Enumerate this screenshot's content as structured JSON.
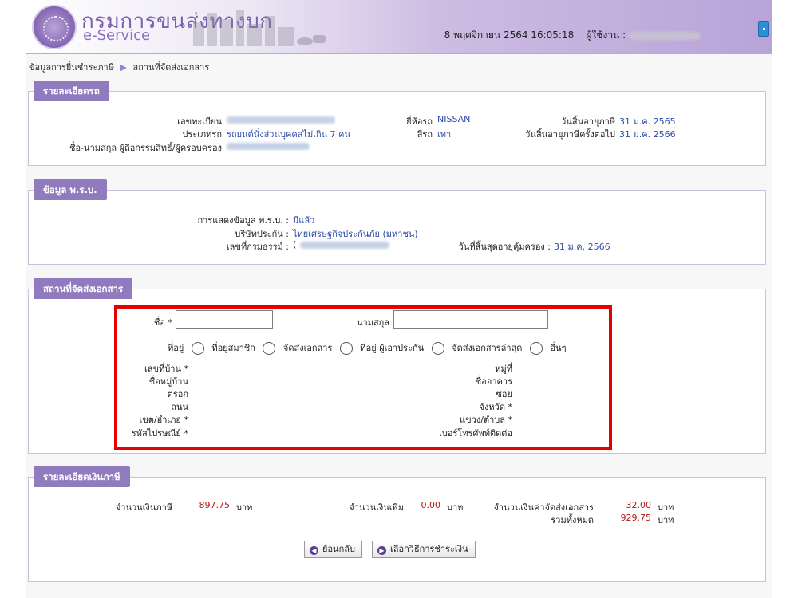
{
  "header": {
    "dept_name": "กรมการขนส่งทางบก",
    "eservice": "e-Service",
    "datetime": "8 พฤศจิกายน 2564 16:05:18",
    "user_label": "ผู้ใช้งาน :"
  },
  "breadcrumb": {
    "item1": "ข้อมูลการยื่นชำระภาษี",
    "item2": "สถานที่จัดส่งเอกสาร"
  },
  "vehicle": {
    "legend": "รายละเอียดรถ",
    "plate_label": "เลขทะเบียน",
    "type_label": "ประเภทรถ",
    "type_value": "รถยนต์นั่งส่วนบุคคลไม่เกิน 7 คน",
    "owner_label": "ชื่อ-นามสกุล ผู้ถือกรรมสิทธิ์/ผู้ครอบครอง",
    "brand_label": "ยี่ห้อรถ",
    "brand_value": "NISSAN",
    "color_label": "สีรถ",
    "color_value": "เทา",
    "tax_expiry_label": "วันสิ้นอายุภาษี",
    "tax_expiry_value": "31 ม.ค. 2565",
    "next_tax_expiry_label": "วันสิ้นอายุภาษีครั้งต่อไป",
    "next_tax_expiry_value": "31 ม.ค. 2566"
  },
  "insurance": {
    "legend": "ข้อมูล พ.ร.บ.",
    "display_label": "การแสดงข้อมูล พ.ร.บ. :",
    "display_value": "มีแล้ว",
    "company_label": "บริษัทประกัน :",
    "company_value": "ไทยเศรษฐกิจประกันภัย (มหาชน)",
    "policy_label": "เลขที่กรมธรรม์ :",
    "policy_visible_char": "(",
    "coverage_end_label": "วันที่สิ้นสุดอายุคุ้มครอง :",
    "coverage_end_value": "31 ม.ค. 2566"
  },
  "delivery": {
    "legend": "สถานที่จัดส่งเอกสาร",
    "first_name_label": "ชื่อ *",
    "last_name_label": "นามสกุล",
    "address_label": "ที่อยู่",
    "options": [
      "ที่อยู่สมาชิก",
      "จัดส่งเอกสาร",
      "ที่อยู่ ผู้เอาประกัน",
      "จัดส่งเอกสารล่าสุด",
      "อื่นๆ"
    ],
    "left_fields": [
      "เลขที่บ้าน *",
      "ชื่อหมู่บ้าน",
      "ตรอก",
      "ถนน",
      "เขต/อำเภอ *",
      "รหัสไปรษณีย์ *"
    ],
    "right_fields": [
      "หมู่ที่",
      "ชื่ออาคาร",
      "ซอย",
      "จังหวัด *",
      "แขวง/ตำบล *",
      "เบอร์โทรศัพท์ติดต่อ"
    ]
  },
  "payment": {
    "legend": "รายละเอียดเงินภาษี",
    "tax_label": "จำนวนเงินภาษี",
    "tax_value": "897.75",
    "extra_label": "จำนวนเงินเพิ่ม",
    "extra_value": "0.00",
    "delivery_fee_label": "จำนวนเงินค่าจัดส่งเอกสาร",
    "delivery_fee_value": "32.00",
    "total_label": "รวมทั้งหมด",
    "total_value": "929.75",
    "currency": "บาท"
  },
  "buttons": {
    "back": "ย้อนกลับ",
    "choose_payment": "เลือกวิธีการชำระเงิน"
  },
  "colors": {
    "legend_bg": "#8f7bbd",
    "value_blue": "#2a4aa8",
    "money_red": "#b01818",
    "highlight_red": "#e50000"
  }
}
